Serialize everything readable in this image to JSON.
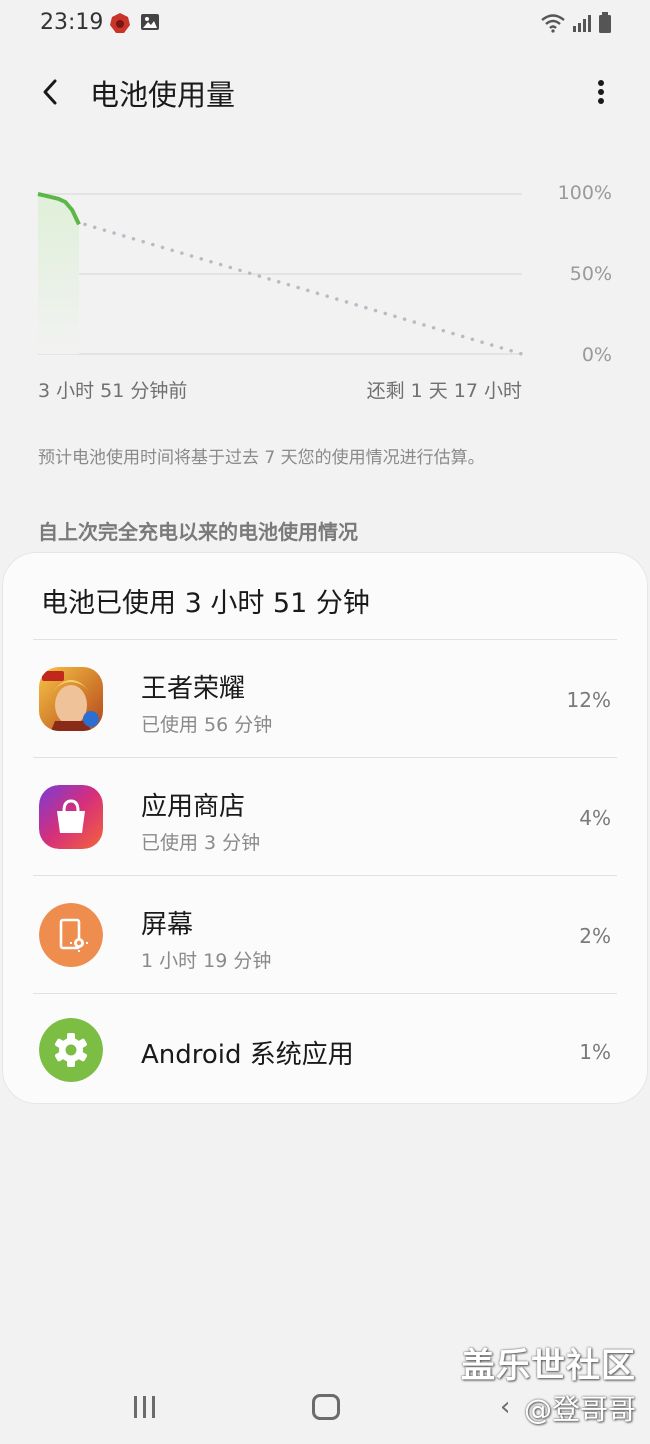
{
  "status_bar": {
    "time": "23:19",
    "icons": [
      "game-badge-icon",
      "image-icon",
      "wifi-icon",
      "signal-icon",
      "battery-icon"
    ]
  },
  "header": {
    "title": "电池使用量",
    "back_icon": "chevron-left-icon",
    "more_icon": "more-vertical-icon"
  },
  "chart": {
    "y_ticks": [
      "100%",
      "50%",
      "0%"
    ],
    "x_start_label": "3 小时 51 分钟前",
    "x_end_label": "还剩 1 天 17 小时",
    "colors": {
      "actual": "#5cb648",
      "fill": "#dff0d8",
      "projection": "#b4bcc4",
      "grid": "#e0e0e0"
    }
  },
  "chart_data": {
    "type": "line",
    "ylim": [
      0,
      100
    ],
    "series": [
      {
        "values": [
          100,
          99,
          98,
          97,
          95,
          90,
          81
        ]
      },
      {
        "values": [
          81,
          0
        ]
      }
    ]
  },
  "estimate_note": "预计电池使用时间将基于过去 7 天您的使用情况进行估算。",
  "section_heading": "自上次完全充电以来的电池使用情况",
  "usage_card": {
    "total": "电池已使用 3 小时 51 分钟",
    "apps": [
      {
        "name": "王者荣耀",
        "sub": "已使用 56 分钟",
        "percent": "12%",
        "icon": "honor-of-kings-icon"
      },
      {
        "name": "应用商店",
        "sub": "已使用 3 分钟",
        "percent": "4%",
        "icon": "app-store-bag-icon"
      },
      {
        "name": "屏幕",
        "sub": "1 小时 19 分钟",
        "percent": "2%",
        "icon": "screen-brightness-icon"
      },
      {
        "name": "Android 系统应用",
        "sub": "",
        "percent": "1%",
        "icon": "system-gear-icon"
      }
    ]
  },
  "nav_bar": {
    "icons": [
      "recent-apps-icon",
      "home-icon",
      "back-icon"
    ]
  },
  "watermark": {
    "title": "盖乐世社区",
    "user": "@登哥哥"
  }
}
